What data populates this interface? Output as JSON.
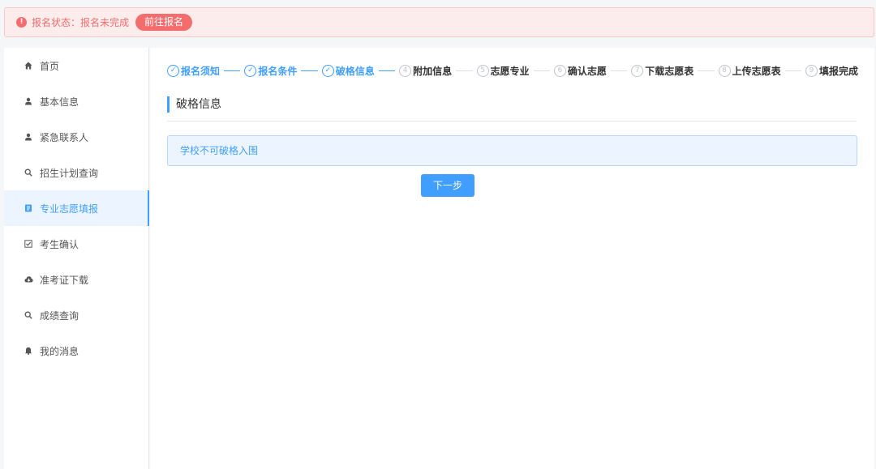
{
  "alert": {
    "icon": "exclamation-icon",
    "status_text": "报名状态：报名未完成",
    "action_label": "前往报名",
    "color": "#f56c6c"
  },
  "sidebar": {
    "items": [
      {
        "label": "首页",
        "icon": "home-icon"
      },
      {
        "label": "基本信息",
        "icon": "user-icon"
      },
      {
        "label": "紧急联系人",
        "icon": "user-icon"
      },
      {
        "label": "招生计划查询",
        "icon": "search-icon"
      },
      {
        "label": "专业志愿填报",
        "icon": "document-icon",
        "active": true
      },
      {
        "label": "考生确认",
        "icon": "checkbox-icon"
      },
      {
        "label": "准考证下载",
        "icon": "cloud-download-icon"
      },
      {
        "label": "成绩查询",
        "icon": "search-icon"
      },
      {
        "label": "我的消息",
        "icon": "bell-icon"
      }
    ]
  },
  "steps": [
    {
      "num": "✓",
      "label": "报名须知",
      "done": true
    },
    {
      "num": "✓",
      "label": "报名条件",
      "done": true
    },
    {
      "num": "✓",
      "label": "破格信息",
      "done": true
    },
    {
      "num": "4",
      "label": "附加信息",
      "done": false
    },
    {
      "num": "5",
      "label": "志愿专业",
      "done": false
    },
    {
      "num": "6",
      "label": "确认志愿",
      "done": false
    },
    {
      "num": "7",
      "label": "下载志愿表",
      "done": false
    },
    {
      "num": "8",
      "label": "上传志愿表",
      "done": false
    },
    {
      "num": "9",
      "label": "填报完成",
      "done": false
    }
  ],
  "main": {
    "section_title": "破格信息",
    "info_text": "学校不可破格入围",
    "next_button": "下一步"
  },
  "colors": {
    "accent": "#409eff",
    "danger": "#f56c6c"
  }
}
